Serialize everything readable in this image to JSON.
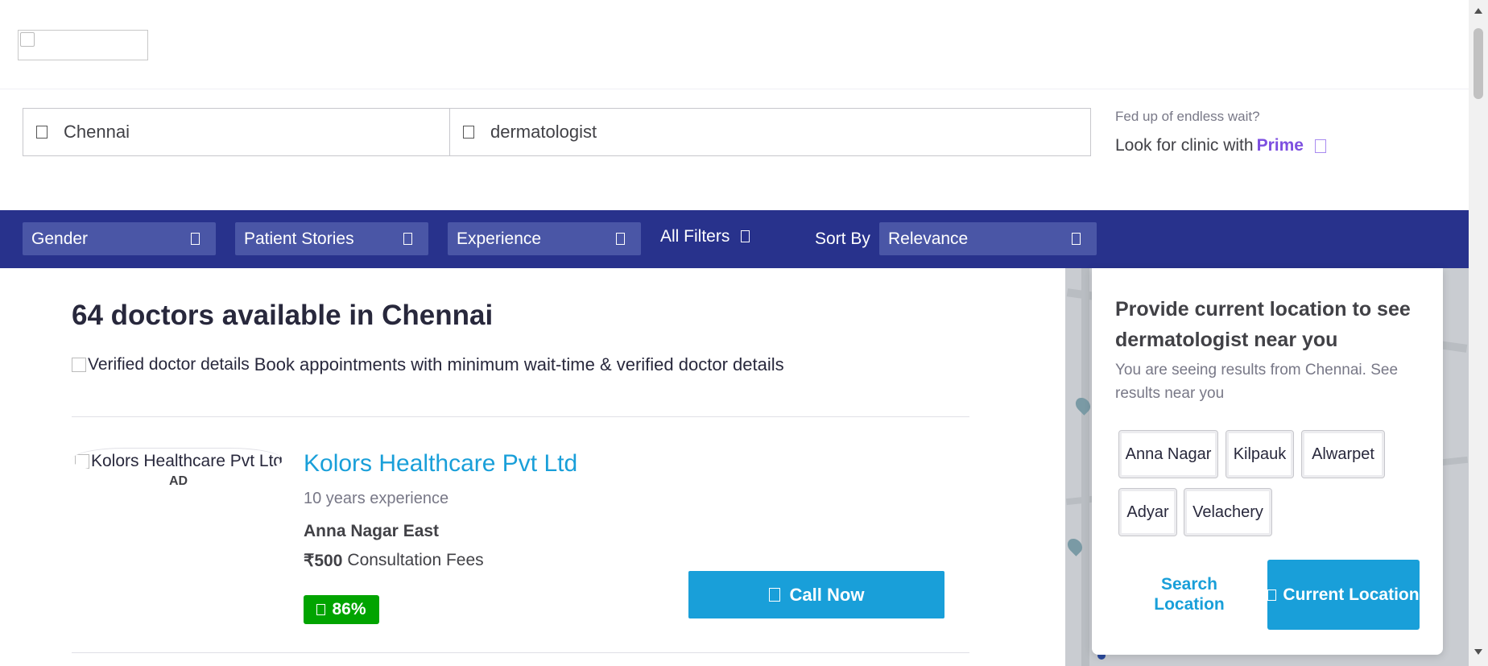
{
  "header": {
    "logo_alt": ""
  },
  "search": {
    "location_value": "Chennai",
    "location_icon": "location-icon",
    "specialty_value": "dermatologist",
    "specialty_icon": "search-icon"
  },
  "prime": {
    "question": "Fed up of endless wait?",
    "lead": "Look for clinic with",
    "brand": "Prime",
    "brand_color": "#7d4fe0"
  },
  "filters": {
    "bar_color": "#28328c",
    "gender": "Gender",
    "patient_stories": "Patient Stories",
    "experience": "Experience",
    "all_filters": "All Filters",
    "sort_by_label": "Sort By",
    "sort_value": "Relevance"
  },
  "results": {
    "title": "64 doctors available in Chennai",
    "verified_img_alt": "Verified doctor details",
    "verified_text": "Book appointments with minimum wait-time & verified doctor details"
  },
  "doctor": {
    "photo_alt": "Kolors Healthcare Pvt Ltd",
    "ad_tag": "AD",
    "name": "Kolors Healthcare Pvt Ltd",
    "experience": "10 years experience",
    "area": "Anna Nagar East",
    "fee_amount": "₹500",
    "fee_label": "Consultation Fees",
    "rating": "86%",
    "call_label": "Call Now",
    "accent_color": "#199fd9",
    "rating_color": "#01a400"
  },
  "location_popup": {
    "title": "Provide current location to see dermatologist near you",
    "subtitle": "You are seeing results from Chennai. See results near you",
    "localities": [
      "Anna Nagar",
      "Kilpauk",
      "Alwarpet",
      "Adyar",
      "Velachery"
    ],
    "search_location": "Search Location",
    "current_location": "Current Location"
  }
}
